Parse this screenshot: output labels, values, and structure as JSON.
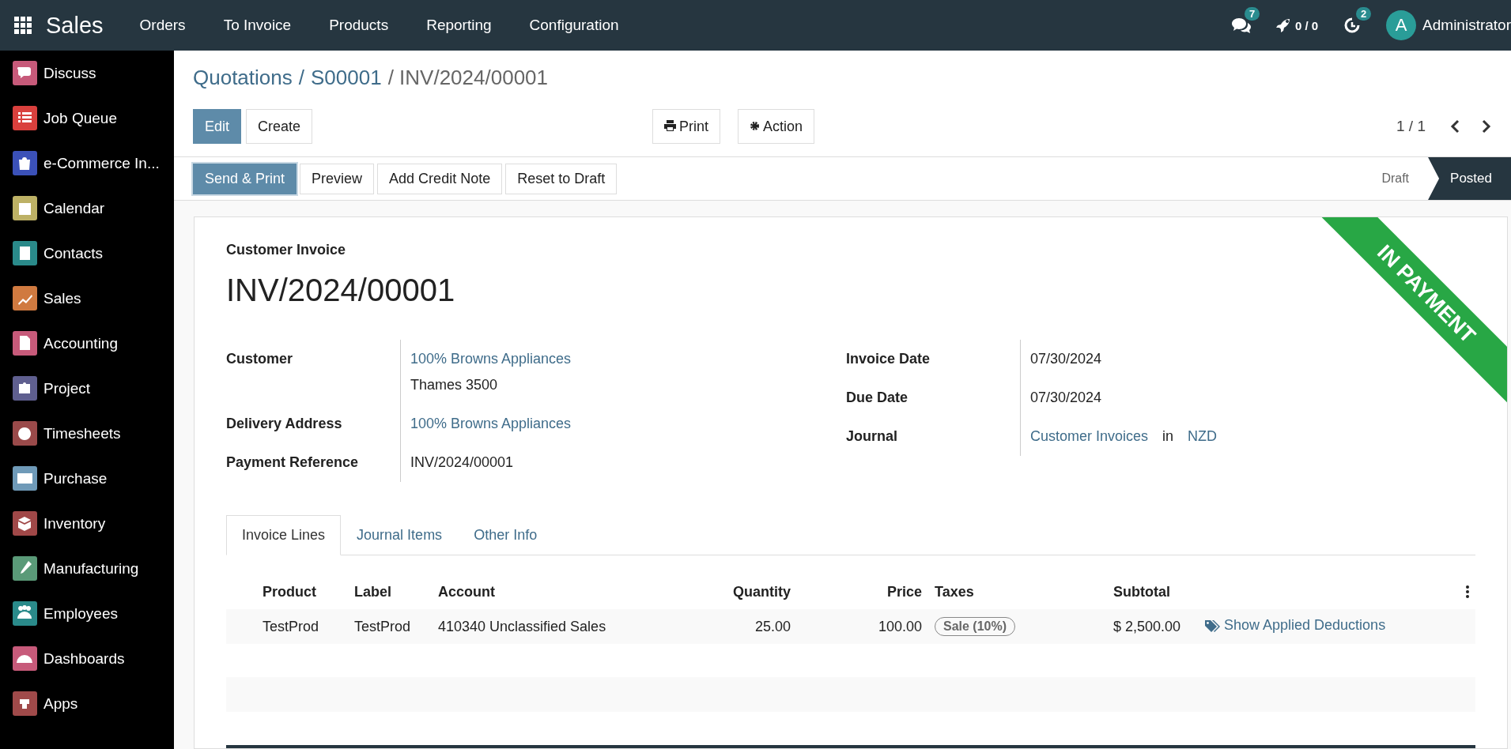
{
  "topbar": {
    "app_title": "Sales",
    "menu": [
      "Orders",
      "To Invoice",
      "Products",
      "Reporting",
      "Configuration"
    ],
    "chat_badge": "7",
    "activity_count": "0 / 0",
    "clock_badge": "2",
    "avatar_letter": "A",
    "user_name": "Administrator"
  },
  "sidebar": {
    "items": [
      {
        "label": "Discuss",
        "color": "#c75a7a"
      },
      {
        "label": "Job Queue",
        "color": "#d9403d"
      },
      {
        "label": "e-Commerce In...",
        "color": "#3b51b8"
      },
      {
        "label": "Calendar",
        "color": "#bdb165"
      },
      {
        "label": "Contacts",
        "color": "#2a8a8a"
      },
      {
        "label": "Sales",
        "color": "#d07a40"
      },
      {
        "label": "Accounting",
        "color": "#c75a7a"
      },
      {
        "label": "Project",
        "color": "#5f5f8f"
      },
      {
        "label": "Timesheets",
        "color": "#9a4a4a"
      },
      {
        "label": "Purchase",
        "color": "#6f9ab8"
      },
      {
        "label": "Inventory",
        "color": "#a04848"
      },
      {
        "label": "Manufacturing",
        "color": "#5a9a78"
      },
      {
        "label": "Employees",
        "color": "#2a8a8a"
      },
      {
        "label": "Dashboards",
        "color": "#c75a7a"
      },
      {
        "label": "Apps",
        "color": "#a04a4a"
      }
    ]
  },
  "breadcrumb": [
    {
      "label": "Quotations",
      "kind": "link"
    },
    {
      "label": "/",
      "kind": "separator"
    },
    {
      "label": "S00001",
      "kind": "link"
    },
    {
      "label": "/ INV/2024/00001",
      "kind": "current"
    }
  ],
  "main_buttons": [
    {
      "label": "Edit",
      "kind": "primary"
    },
    {
      "label": "Create",
      "kind": "secondary"
    }
  ],
  "menu_buttons": [
    "Print",
    "Action"
  ],
  "pager": "1 / 1",
  "action_buttons": [
    {
      "label": "Send & Print",
      "kind": "primary"
    },
    {
      "label": "Preview",
      "kind": "secondary"
    },
    {
      "label": "Add Credit Note",
      "kind": "secondary"
    },
    {
      "label": "Reset to Draft",
      "kind": "secondary"
    }
  ],
  "status_bar": [
    {
      "label": "Draft",
      "selected": false
    },
    {
      "label": "Posted",
      "selected": true
    }
  ],
  "form": {
    "ribbon": "IN PAYMENT",
    "subtitle": "Customer Invoice",
    "title": "INV/2024/00001",
    "left_fields": [
      {
        "label": "Customer",
        "values": [
          {
            "text": "100% Browns Appliances",
            "kind": "link"
          },
          {
            "text": "Thames 3500",
            "kind": "text"
          }
        ]
      },
      {
        "label": "Delivery Address",
        "values": [
          {
            "text": "100% Browns Appliances",
            "kind": "link"
          }
        ]
      },
      {
        "label": "Payment Reference",
        "values": [
          {
            "text": "INV/2024/00001",
            "kind": "text"
          }
        ]
      }
    ],
    "right_fields": [
      {
        "label": "Invoice Date",
        "values": [
          {
            "text": "07/30/2024",
            "kind": "text"
          }
        ]
      },
      {
        "label": "Due Date",
        "values": [
          {
            "text": "07/30/2024",
            "kind": "text"
          }
        ]
      },
      {
        "label": "Journal",
        "values": [
          {
            "text": "Customer Invoices",
            "kind": "link"
          },
          {
            "text": "in",
            "kind": "text"
          },
          {
            "text": "NZD",
            "kind": "link"
          }
        ]
      }
    ],
    "tabs": [
      {
        "label": "Invoice Lines",
        "selected": true
      },
      {
        "label": "Journal Items",
        "selected": false
      },
      {
        "label": "Other Info",
        "selected": false
      }
    ],
    "table": {
      "columns": [
        "Product",
        "Label",
        "Account",
        "Quantity",
        "Price",
        "Taxes",
        "Subtotal"
      ],
      "rows": [
        {
          "product": "TestProd",
          "label": "TestProd",
          "account": "410340 Unclassified Sales",
          "quantity": "25.00",
          "price": "100.00",
          "taxes": [
            "Sale (10%)"
          ],
          "subtotal": "$ 2,500.00",
          "link": "Show Applied Deductions"
        }
      ]
    }
  }
}
